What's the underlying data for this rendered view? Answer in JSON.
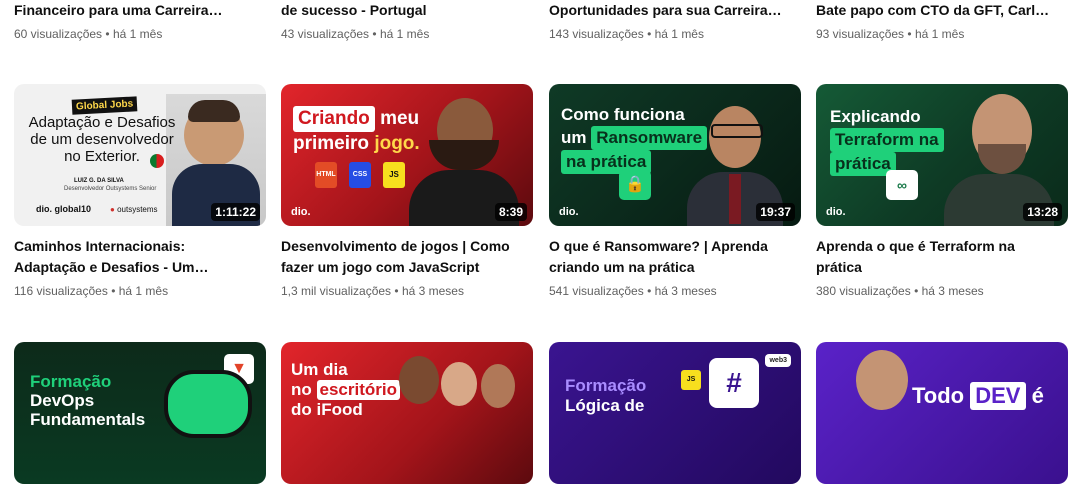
{
  "top_row": [
    {
      "title": "Financeiro para uma Carreira…",
      "views": "60 visualizações",
      "age": "há 1 mês"
    },
    {
      "title": "de sucesso - Portugal",
      "views": "43 visualizações",
      "age": "há 1 mês"
    },
    {
      "title": "Oportunidades para sua Carreira…",
      "views": "143 visualizações",
      "age": "há 1 mês"
    },
    {
      "title": "Bate papo com CTO da GFT, Carlo…",
      "views": "93 visualizações",
      "age": "há 1 mês"
    }
  ],
  "middle_row": [
    {
      "thumb_badge": "Global Jobs",
      "thumb_line1": "Adaptação e Desafios",
      "thumb_line2": "de um desenvolvedor",
      "thumb_line3": "no Exterior.",
      "thumb_name": "LUIZ G. DA SILVA",
      "thumb_role": "Desenvolvedor Outsystems Senior",
      "thumb_logo_left": "dio. global10",
      "thumb_logo_right": "outsystems",
      "duration": "1:11:22",
      "title_line1": "Caminhos Internacionais:",
      "title_line2": "Adaptação e Desafios - Um…",
      "views": "116 visualizações",
      "age": "há 1 mês"
    },
    {
      "thumb_word1": "Criando",
      "thumb_word2": "meu",
      "thumb_word3": "primeiro",
      "thumb_word4": "jogo.",
      "thumb_logo": "dio.",
      "chip_html": "HTML",
      "chip_css": "CSS",
      "chip_js": "JS",
      "duration": "8:39",
      "title_line1": "Desenvolvimento de jogos | Como",
      "title_line2": "fazer um jogo com JavaScript",
      "views": "1,3 mil visualizações",
      "age": "há 3 meses"
    },
    {
      "thumb_line1": "Como funciona",
      "thumb_line2a": "um",
      "thumb_line2b": "Ransomware",
      "thumb_line3": "na prática",
      "thumb_logo": "dio.",
      "duration": "19:37",
      "title_line1": "O que é Ransomware? | Aprenda",
      "title_line2": "criando um na prática",
      "views": "541 visualizações",
      "age": "há 3 meses"
    },
    {
      "thumb_line1": "Explicando",
      "thumb_line2": "Terraform na",
      "thumb_line3": "prática",
      "thumb_logo": "dio.",
      "duration": "13:28",
      "title_line1": "Aprenda o que é Terraform na",
      "title_line2": "prática",
      "views": "380 visualizações",
      "age": "há 3 meses"
    }
  ],
  "bottom_row": [
    {
      "thumb_line1": "Formação",
      "thumb_line2": "DevOps",
      "thumb_line3": "Fundamentals"
    },
    {
      "thumb_line1": "Um dia",
      "thumb_line2a": "no",
      "thumb_line2b": "escritório",
      "thumb_line3": "do iFood"
    },
    {
      "thumb_line1": "Formação",
      "thumb_line2": "Lógica de",
      "thumb_badge": "web3"
    },
    {
      "thumb_line1a": "Todo",
      "thumb_line1b": "DEV",
      "thumb_line1c": "é"
    }
  ],
  "separator": "•",
  "colors": {
    "text_primary": "#0f0f0f",
    "text_secondary": "#606060",
    "dio_green": "#1fd07a",
    "dio_dark": "#0b2a1c",
    "red_theme": "#b0121a",
    "purple_theme": "#4b1aa8"
  }
}
